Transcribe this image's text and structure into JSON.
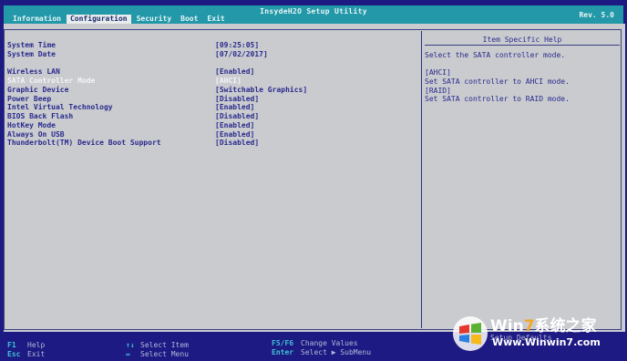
{
  "header": {
    "title": "InsydeH2O Setup Utility",
    "revision": "Rev. 5.0",
    "tabs": [
      "Information",
      "Configuration",
      "Security",
      "Boot",
      "Exit"
    ],
    "active_tab": "Configuration"
  },
  "settings": {
    "system_time": {
      "label": "System Time",
      "value": "[09:25:05]"
    },
    "system_date": {
      "label": "System Date",
      "value": "[07/02/2017]"
    },
    "items": [
      {
        "label": "Wireless LAN",
        "value": "[Enabled]"
      },
      {
        "label": "SATA Controller Mode",
        "value": "[AHCI]",
        "selected": true
      },
      {
        "label": "Graphic Device",
        "value": "[Switchable Graphics]"
      },
      {
        "label": "Power Beep",
        "value": "[Disabled]"
      },
      {
        "label": "Intel Virtual Technology",
        "value": "[Enabled]"
      },
      {
        "label": "BIOS Back Flash",
        "value": "[Disabled]"
      },
      {
        "label": "HotKey Mode",
        "value": "[Enabled]"
      },
      {
        "label": "Always On USB",
        "value": "[Enabled]"
      },
      {
        "label": "Thunderbolt(TM) Device Boot Support",
        "value": "[Disabled]"
      }
    ]
  },
  "help": {
    "title": "Item Specific Help",
    "lines": [
      "Select the SATA controller mode.",
      "",
      "[AHCI]",
      "Set SATA controller to AHCI mode.",
      "[RAID]",
      "Set SATA controller to RAID mode."
    ]
  },
  "footer": {
    "f1_key": "F1",
    "f1_desc": "Help",
    "esc_key": "Esc",
    "esc_desc": "Exit",
    "updown_key": "↑↓",
    "updown_desc": "Select Item",
    "leftright_key": "↔",
    "leftright_desc": "Select Menu",
    "f5f6_key": "F5/F6",
    "f5f6_desc": "Change Values",
    "enter_key": "Enter",
    "enter_desc": "Select ▶ SubMenu",
    "f9_desc": "Setup Defaults"
  },
  "watermark": {
    "brand_prefix": "Win",
    "brand_7": "7",
    "brand_suffix": "系统之家",
    "url": "Www.Winwin7.com"
  },
  "colors": {
    "background": "#1d1a83",
    "menu_bar": "#2298a8",
    "panel": "#c9cbcf",
    "text": "#2a2a8c",
    "selected_text": "#f3f4f7",
    "footer_key": "#3ec3d4"
  }
}
